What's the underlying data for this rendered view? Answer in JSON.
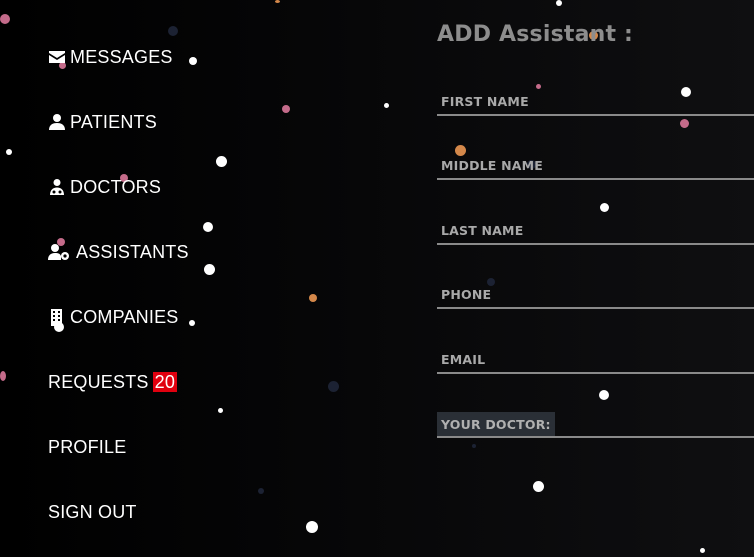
{
  "nav": {
    "items": [
      {
        "label": "MESSAGES",
        "icon": "envelope-icon"
      },
      {
        "label": "PATIENTS",
        "icon": "user-icon"
      },
      {
        "label": "DOCTORS",
        "icon": "doctor-icon"
      },
      {
        "label": "ASSISTANTS",
        "icon": "user-gear-icon"
      },
      {
        "label": "COMPANIES",
        "icon": "building-icon"
      },
      {
        "label": "REQUESTS",
        "icon": "",
        "badge": "20"
      },
      {
        "label": "PROFILE",
        "icon": ""
      },
      {
        "label": "SIGN OUT",
        "icon": ""
      }
    ]
  },
  "form": {
    "title": "ADD Assistant :",
    "fields": [
      {
        "label": "FIRST NAME",
        "value": ""
      },
      {
        "label": "MIDDLE NAME",
        "value": ""
      },
      {
        "label": "LAST NAME",
        "value": ""
      },
      {
        "label": "PHONE",
        "value": ""
      },
      {
        "label": "EMAIL",
        "value": ""
      }
    ],
    "doctor_label": "YOUR DOCTOR:"
  },
  "colors": {
    "badge": "#e0000f",
    "form_text": "#8d8d8d"
  }
}
